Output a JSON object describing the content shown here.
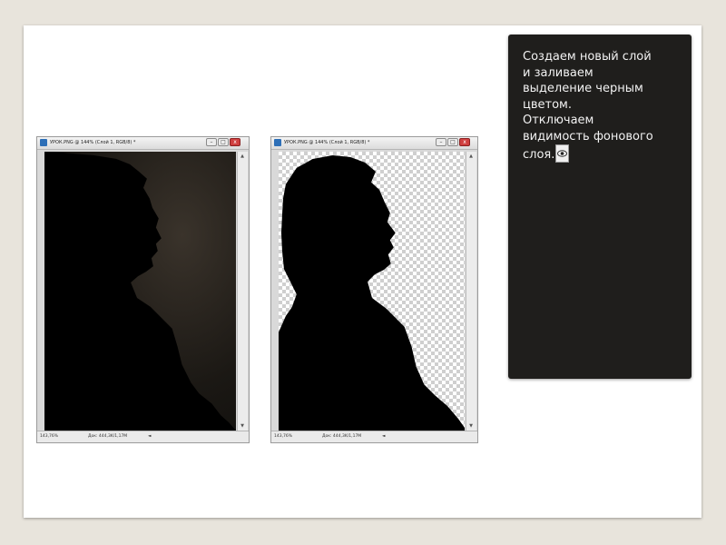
{
  "windows": [
    {
      "title": "УРОК.PNG @ 144% (Слой 1, RGB/8) *",
      "zoom": "143,76%",
      "doc_size": "Док: 444,3K/1,17M",
      "status_arrow": "◄",
      "background": "dark"
    },
    {
      "title": "УРОК.PNG @ 144% (Слой 1, RGB/8) *",
      "zoom": "143,76%",
      "doc_size": "Док: 444,3K/1,17M",
      "status_arrow": "◄",
      "background": "transparent"
    }
  ],
  "window_controls": {
    "minimize": "–",
    "maximize": "□",
    "close": "x"
  },
  "panel": {
    "line1": "Создаем новый слой",
    "line2": "и заливаем",
    "line3": "выделение черным",
    "line4": "цветом.",
    "line5": "Отключаем",
    "line6": "видимость фонового",
    "line7": "слоя.",
    "icon": "eye-icon"
  },
  "colors": {
    "page_bg": "#e8e4dc",
    "panel_bg": "#1f1e1c",
    "panel_text": "#f2f2f2",
    "silhouette": "#000000"
  }
}
